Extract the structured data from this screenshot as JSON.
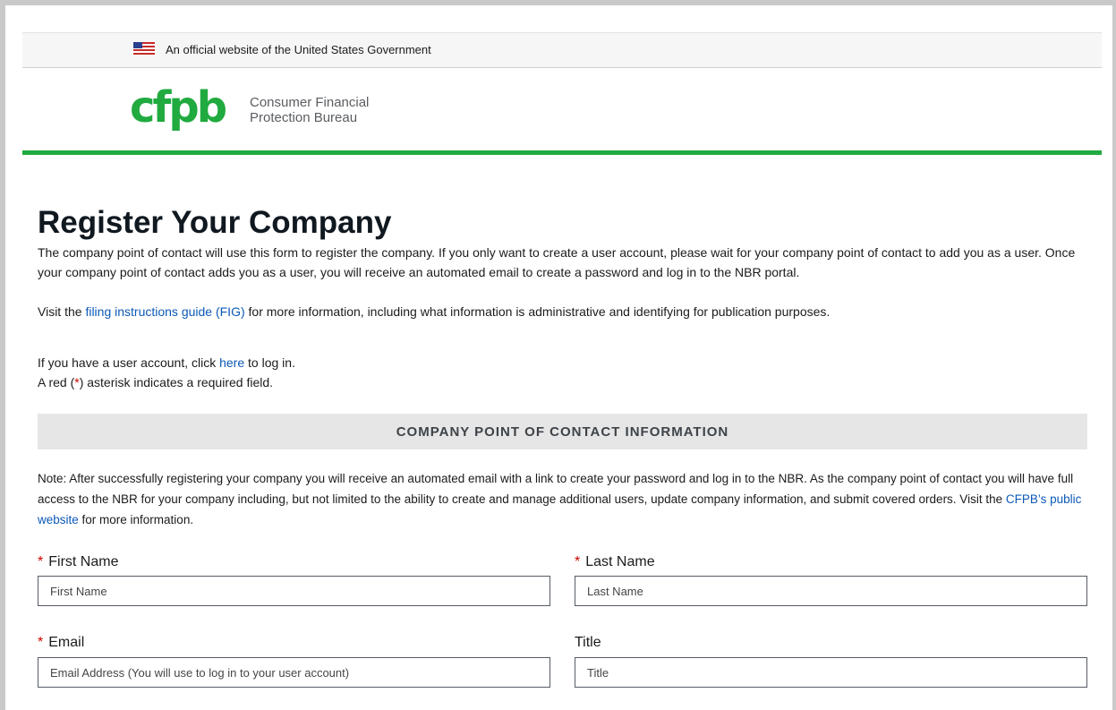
{
  "banner": {
    "text": "An official website of the United States Government"
  },
  "logo": {
    "mark": "cfpb",
    "line1": "Consumer Financial",
    "line2": "Protection Bureau"
  },
  "page": {
    "title": "Register Your Company",
    "intro": "The company point of contact will use this form to register the company. If you only want to create a user account, please wait for your company point of contact to add you as a user. Once your company point of contact adds you as a user, you will receive an automated email to create a password and log in to the NBR portal.",
    "visit_prefix": "Visit the ",
    "fig_link": "filing instructions guide (FIG)",
    "visit_suffix": " for more information, including what information is administrative and identifying for publication purposes.",
    "login_prefix": "If you have a user account, click ",
    "login_link": "here",
    "login_suffix": " to log in.",
    "required_prefix": "A red (",
    "required_star": "*",
    "required_suffix": ") asterisk indicates a required field."
  },
  "section": {
    "title": "COMPANY POINT OF CONTACT INFORMATION",
    "note_prefix": "Note: After successfully registering your company you will receive an automated email with a link to create your password and log in to the NBR. As the company point of contact you will have full access to the NBR for your company including, but not limited to the ability to create and manage additional users, update company information, and submit covered orders. Visit the ",
    "note_link": "CFPB’s public website",
    "note_suffix": " for more information."
  },
  "form": {
    "first_name": {
      "label": "First Name",
      "required": "*",
      "placeholder": "First Name"
    },
    "last_name": {
      "label": "Last Name",
      "required": "*",
      "placeholder": "Last Name"
    },
    "email": {
      "label": "Email",
      "required": "*",
      "placeholder": "Email Address (You will use to log in to your user account)"
    },
    "title": {
      "label": "Title",
      "placeholder": "Title"
    }
  },
  "colors": {
    "brand_green": "#20aa3f",
    "link": "#0d59b7",
    "required_red": "#d10000"
  }
}
